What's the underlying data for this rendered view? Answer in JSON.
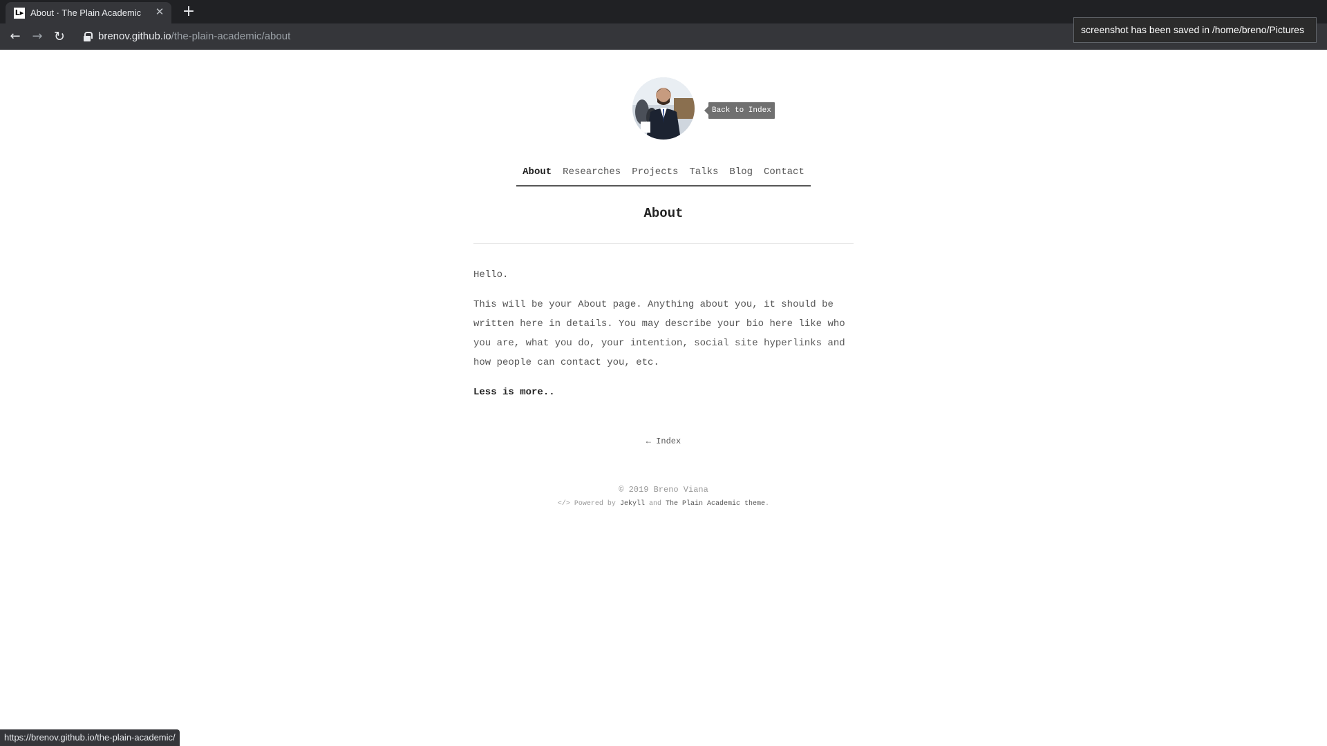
{
  "browser": {
    "tab_title": "About · The Plain Academic",
    "favicon_label": "L▸",
    "close_glyph": "✕",
    "new_tab_glyph": "+",
    "url_host": "brenov.github.io",
    "url_path": "/the-plain-academic/about",
    "back_glyph": "←",
    "forward_glyph": "→",
    "reload_glyph": "↻",
    "star_glyph": "☆",
    "ext_glyph": "▪",
    "menu_glyph": "⋮",
    "status_url": "https://brenov.github.io/the-plain-academic/"
  },
  "notification": {
    "text": "screenshot has been saved in /home/breno/Pictures"
  },
  "header": {
    "tooltip": "Back to Index"
  },
  "nav": {
    "items": [
      "About",
      "Researches",
      "Projects",
      "Talks",
      "Blog",
      "Contact"
    ],
    "active": "About"
  },
  "main": {
    "title": "About",
    "greeting": "Hello.",
    "body": "This will be your About page. Anything about you, it should be written here in details. You may describe your bio here like who you are, what you do, your intention, social site hyperlinks and how people can contact you, etc.",
    "tagline": "Less is more.."
  },
  "footer": {
    "back_link": "← Index",
    "copyright": "© 2019 Breno Viana",
    "powered_prefix": "</> Powered by",
    "jekyll": "Jekyll",
    "and": "and",
    "theme": "The Plain Academic theme",
    "period": "."
  },
  "colors": {
    "chrome_dark": "#202124",
    "chrome_toolbar": "#35363a",
    "text_main": "#555555",
    "tooltip_bg": "#707070"
  }
}
